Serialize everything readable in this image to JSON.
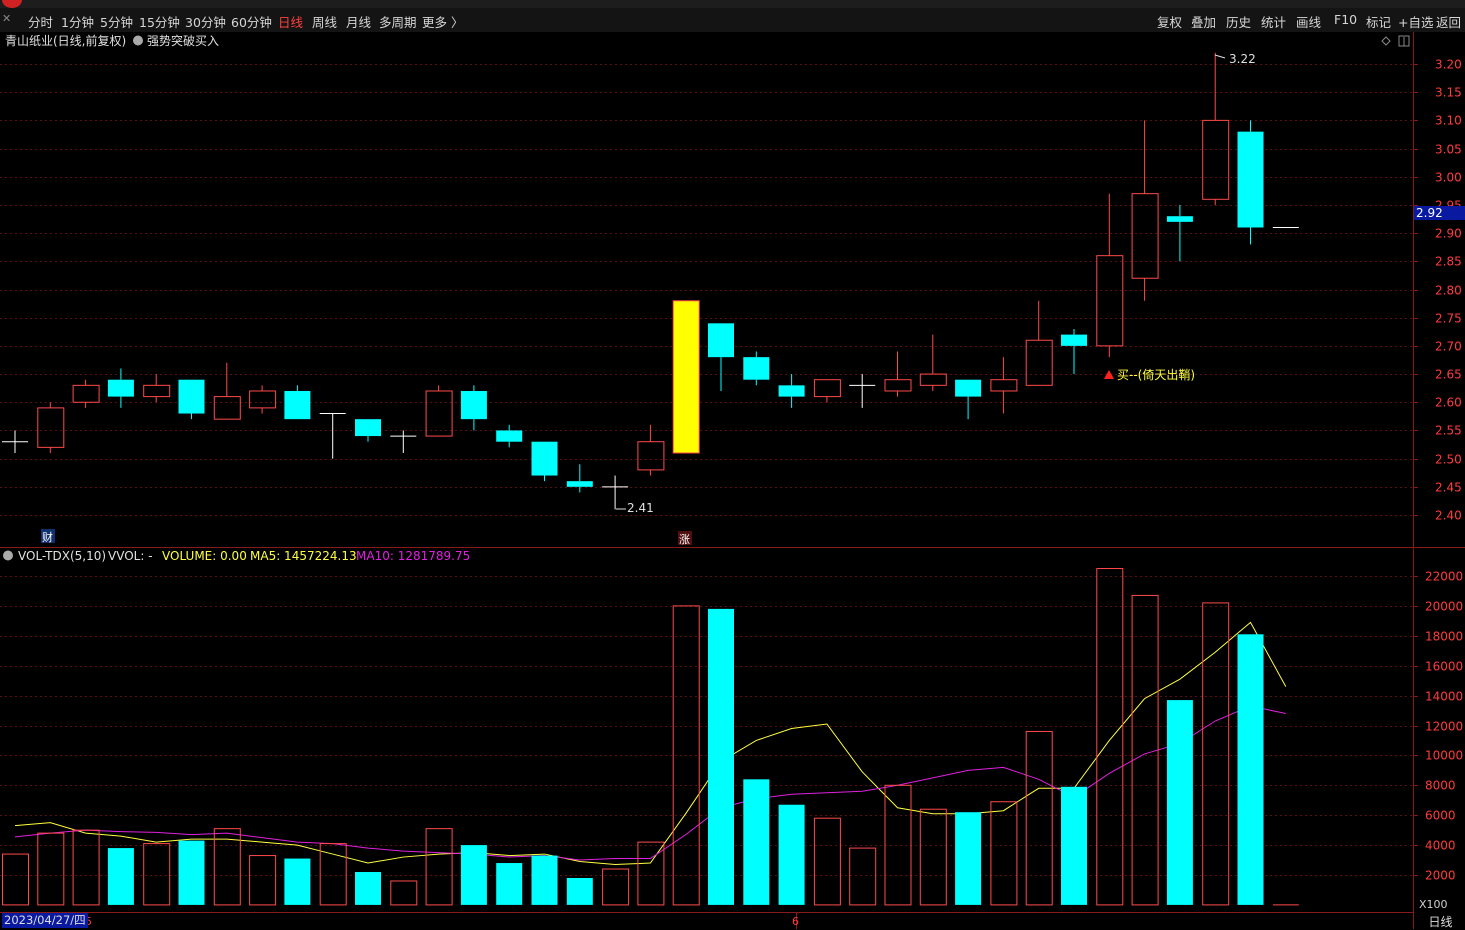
{
  "toolbar": {
    "periods": [
      "分时",
      "1分钟",
      "5分钟",
      "15分钟",
      "30分钟",
      "60分钟",
      "日线",
      "周线",
      "月线",
      "多周期",
      "更多 〉"
    ],
    "active_period": "日线",
    "right_buttons": [
      "复权",
      "叠加",
      "历史",
      "统计",
      "画线",
      "F10",
      "标记",
      "+自选",
      "返回"
    ]
  },
  "main_panel": {
    "stock_title": "青山纸业(日线,前复权)",
    "indicator_name": "强势突破买入",
    "high_marker": "3.22",
    "low_marker": "2.41",
    "buy_signal": "买--(倚天出鞘)",
    "current_price": "2.92",
    "markers": {
      "cai": "财",
      "zhang": "涨"
    },
    "y_ticks": [
      "3.20",
      "3.15",
      "3.10",
      "3.05",
      "3.00",
      "2.95",
      "2.90",
      "2.85",
      "2.80",
      "2.75",
      "2.70",
      "2.65",
      "2.60",
      "2.55",
      "2.50",
      "2.45",
      "2.40"
    ]
  },
  "volume_panel": {
    "indicator_name": "VOL-TDX(5,10)",
    "vvol": "VVOL: -",
    "volume_text": "VOLUME: 0.00",
    "ma5_text": "MA5: 1457224.13",
    "ma10_text": "MA10: 1281789.75",
    "y_ticks": [
      "22000",
      "20000",
      "18000",
      "16000",
      "14000",
      "12000",
      "10000",
      "8000",
      "6000",
      "4000",
      "2000"
    ],
    "unit": "X100"
  },
  "footer": {
    "date": "2023/04/27/四",
    "month_marker_1": "5",
    "month_marker_2": "6",
    "period": "日线"
  },
  "colors": {
    "up": "#ff4a4a",
    "down": "#00ffff",
    "highlight": "#ffff00",
    "ma5": "#ffff40",
    "ma10": "#e020e0",
    "grid": "#5a1010",
    "axis_text": "#ff3c3c"
  },
  "chart_data": {
    "type": "candlestick",
    "price_ylim": [
      2.36,
      3.26
    ],
    "volume_ylim": [
      0,
      23000
    ],
    "candles": [
      {
        "o": 2.53,
        "h": 2.55,
        "l": 2.51,
        "c": 2.53,
        "vol": 3400,
        "ma5": 5300,
        "ma10": 4550
      },
      {
        "o": 2.52,
        "h": 2.6,
        "l": 2.51,
        "c": 2.59,
        "vol": 4800,
        "ma5": 5500,
        "ma10": 4800
      },
      {
        "o": 2.6,
        "h": 2.64,
        "l": 2.59,
        "c": 2.63,
        "vol": 5000,
        "ma5": 4800,
        "ma10": 5000
      },
      {
        "o": 2.64,
        "h": 2.66,
        "l": 2.59,
        "c": 2.61,
        "vol": 3800,
        "ma5": 4600,
        "ma10": 4900
      },
      {
        "o": 2.61,
        "h": 2.65,
        "l": 2.6,
        "c": 2.63,
        "vol": 4100,
        "ma5": 4200,
        "ma10": 4850
      },
      {
        "o": 2.64,
        "h": 2.64,
        "l": 2.57,
        "c": 2.58,
        "vol": 4300,
        "ma5": 4400,
        "ma10": 4700
      },
      {
        "o": 2.57,
        "h": 2.67,
        "l": 2.57,
        "c": 2.61,
        "vol": 5100,
        "ma5": 4400,
        "ma10": 4800
      },
      {
        "o": 2.59,
        "h": 2.63,
        "l": 2.58,
        "c": 2.62,
        "vol": 3300,
        "ma5": 4200,
        "ma10": 4500
      },
      {
        "o": 2.62,
        "h": 2.63,
        "l": 2.57,
        "c": 2.57,
        "vol": 3100,
        "ma5": 4000,
        "ma10": 4200
      },
      {
        "o": 2.58,
        "h": 2.58,
        "l": 2.5,
        "c": 2.58,
        "vol": 4100,
        "ma5": 3400,
        "ma10": 4100
      },
      {
        "o": 2.57,
        "h": 2.57,
        "l": 2.53,
        "c": 2.54,
        "vol": 2200,
        "ma5": 2800,
        "ma10": 3800
      },
      {
        "o": 2.54,
        "h": 2.55,
        "l": 2.51,
        "c": 2.54,
        "vol": 1600,
        "ma5": 3200,
        "ma10": 3600
      },
      {
        "o": 2.54,
        "h": 2.63,
        "l": 2.54,
        "c": 2.62,
        "vol": 5100,
        "ma5": 3400,
        "ma10": 3500
      },
      {
        "o": 2.62,
        "h": 2.63,
        "l": 2.55,
        "c": 2.57,
        "vol": 4000,
        "ma5": 3500,
        "ma10": 3400
      },
      {
        "o": 2.55,
        "h": 2.56,
        "l": 2.52,
        "c": 2.53,
        "vol": 2800,
        "ma5": 3300,
        "ma10": 3200
      },
      {
        "o": 2.53,
        "h": 2.53,
        "l": 2.46,
        "c": 2.47,
        "vol": 3300,
        "ma5": 3400,
        "ma10": 3300
      },
      {
        "o": 2.46,
        "h": 2.49,
        "l": 2.44,
        "c": 2.45,
        "vol": 1800,
        "ma5": 2900,
        "ma10": 3000
      },
      {
        "o": 2.45,
        "h": 2.47,
        "l": 2.41,
        "c": 2.45,
        "vol": 2400,
        "ma5": 2700,
        "ma10": 3100
      },
      {
        "o": 2.48,
        "h": 2.56,
        "l": 2.47,
        "c": 2.53,
        "vol": 4200,
        "ma5": 2800,
        "ma10": 3100
      },
      {
        "o": 2.51,
        "h": 2.78,
        "l": 2.51,
        "c": 2.78,
        "vol": 20000,
        "ma5": 6100,
        "ma10": 4700
      },
      {
        "o": 2.74,
        "h": 2.74,
        "l": 2.62,
        "c": 2.68,
        "vol": 19800,
        "ma5": 9600,
        "ma10": 6500
      },
      {
        "o": 2.68,
        "h": 2.69,
        "l": 2.63,
        "c": 2.64,
        "vol": 8400,
        "ma5": 11000,
        "ma10": 7100
      },
      {
        "o": 2.63,
        "h": 2.65,
        "l": 2.59,
        "c": 2.61,
        "vol": 6700,
        "ma5": 11800,
        "ma10": 7400
      },
      {
        "o": 2.61,
        "h": 2.64,
        "l": 2.6,
        "c": 2.64,
        "vol": 5800,
        "ma5": 12100,
        "ma10": 7500
      },
      {
        "o": 2.63,
        "h": 2.65,
        "l": 2.59,
        "c": 2.63,
        "vol": 3800,
        "ma5": 8900,
        "ma10": 7600
      },
      {
        "o": 2.62,
        "h": 2.69,
        "l": 2.61,
        "c": 2.64,
        "vol": 8000,
        "ma5": 6500,
        "ma10": 8000
      },
      {
        "o": 2.63,
        "h": 2.72,
        "l": 2.62,
        "c": 2.65,
        "vol": 6400,
        "ma5": 6100,
        "ma10": 8500
      },
      {
        "o": 2.64,
        "h": 2.64,
        "l": 2.57,
        "c": 2.61,
        "vol": 6200,
        "ma5": 6100,
        "ma10": 9000
      },
      {
        "o": 2.62,
        "h": 2.68,
        "l": 2.58,
        "c": 2.64,
        "vol": 6900,
        "ma5": 6300,
        "ma10": 9200
      },
      {
        "o": 2.63,
        "h": 2.78,
        "l": 2.63,
        "c": 2.71,
        "vol": 11600,
        "ma5": 7800,
        "ma10": 8400
      },
      {
        "o": 2.72,
        "h": 2.73,
        "l": 2.65,
        "c": 2.7,
        "vol": 7900,
        "ma5": 7800,
        "ma10": 7200
      },
      {
        "o": 2.7,
        "h": 2.97,
        "l": 2.68,
        "c": 2.86,
        "vol": 22500,
        "ma5": 11000,
        "ma10": 8800
      },
      {
        "o": 2.82,
        "h": 3.1,
        "l": 2.78,
        "c": 2.97,
        "vol": 20700,
        "ma5": 13800,
        "ma10": 10100
      },
      {
        "o": 2.93,
        "h": 2.95,
        "l": 2.85,
        "c": 2.92,
        "vol": 13700,
        "ma5": 15100,
        "ma10": 10800
      },
      {
        "o": 2.96,
        "h": 3.22,
        "l": 2.95,
        "c": 3.1,
        "vol": 20200,
        "ma5": 16900,
        "ma10": 12300
      },
      {
        "o": 3.08,
        "h": 3.1,
        "l": 2.88,
        "c": 2.91,
        "vol": 18100,
        "ma5": 18900,
        "ma10": 13300
      },
      {
        "o": 2.91,
        "h": 2.91,
        "l": 2.91,
        "c": 2.91,
        "vol": 0,
        "ma5": 14600,
        "ma10": 12800
      }
    ]
  }
}
